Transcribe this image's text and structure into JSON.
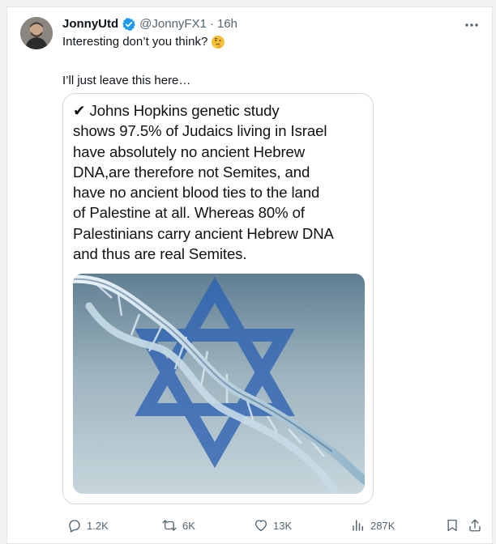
{
  "post": {
    "author_name": "JonnyUtd",
    "handle": "@JonnyFX1",
    "separator": "·",
    "time": "16h",
    "text_line1": "Interesting don’t you think?",
    "text_line2": "I’ll just leave this here…",
    "emoji": "thinking-face",
    "verified_color": "#1d9bf0"
  },
  "media": {
    "text": "✔ Johns Hopkins genetic study\nshows 97.5% of Judaics living in Israel\nhave absolutely no ancient Hebrew\nDNA,are therefore not Semites, and\nhave no ancient blood ties to the land\nof Palestine at all. Whereas 80% of\nPalestinians carry ancient Hebrew DNA\nand thus are real Semites.",
    "image_subject": "dna-helix-over-star-of-david",
    "star_color": "#2f63b3"
  },
  "actions": {
    "replies": "1.2K",
    "reposts": "6K",
    "likes": "13K",
    "views": "287K",
    "reply_icon": "reply-icon",
    "repost_icon": "repost-icon",
    "like_icon": "heart-icon",
    "views_icon": "views-icon",
    "bookmark_icon": "bookmark-icon",
    "share_icon": "share-icon"
  },
  "colors": {
    "text": "#0f1419",
    "secondary": "#536471",
    "border": "#cfd9de"
  }
}
